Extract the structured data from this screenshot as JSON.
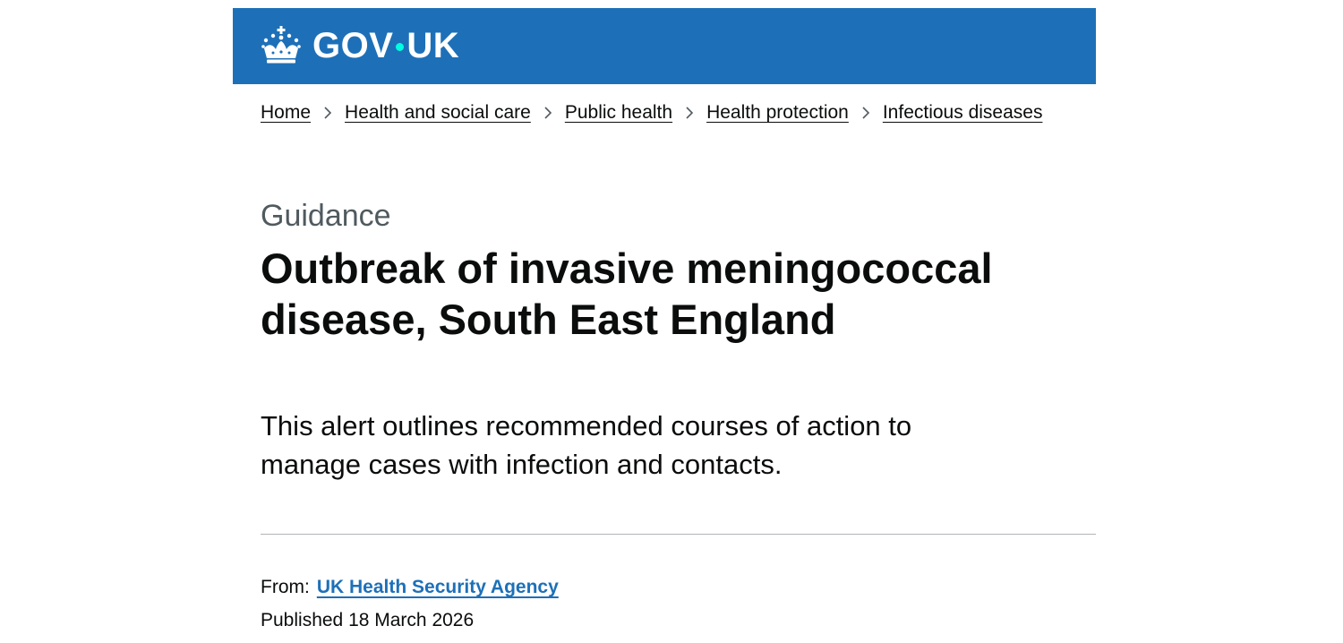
{
  "header": {
    "logo_text_left": "GOV",
    "logo_text_right": "UK",
    "logo_icon": "crown-icon",
    "background_color": "#1d70b8",
    "dot_color": "#00ffe0"
  },
  "breadcrumbs": [
    {
      "label": "Home"
    },
    {
      "label": "Health and social care"
    },
    {
      "label": "Public health"
    },
    {
      "label": "Health protection"
    },
    {
      "label": "Infectious diseases"
    }
  ],
  "breadcrumb_separator_icon": "chevron-right-icon",
  "main": {
    "caption": "Guidance",
    "title": "Outbreak of invasive meningococcal disease, South East England",
    "lead": "This alert outlines recommended courses of action to manage cases with infection and contacts."
  },
  "metadata": {
    "from_label": "From:",
    "from_link": "UK Health Security Agency",
    "link_color": "#1d70b8",
    "published": "Published 18 March 2026"
  }
}
